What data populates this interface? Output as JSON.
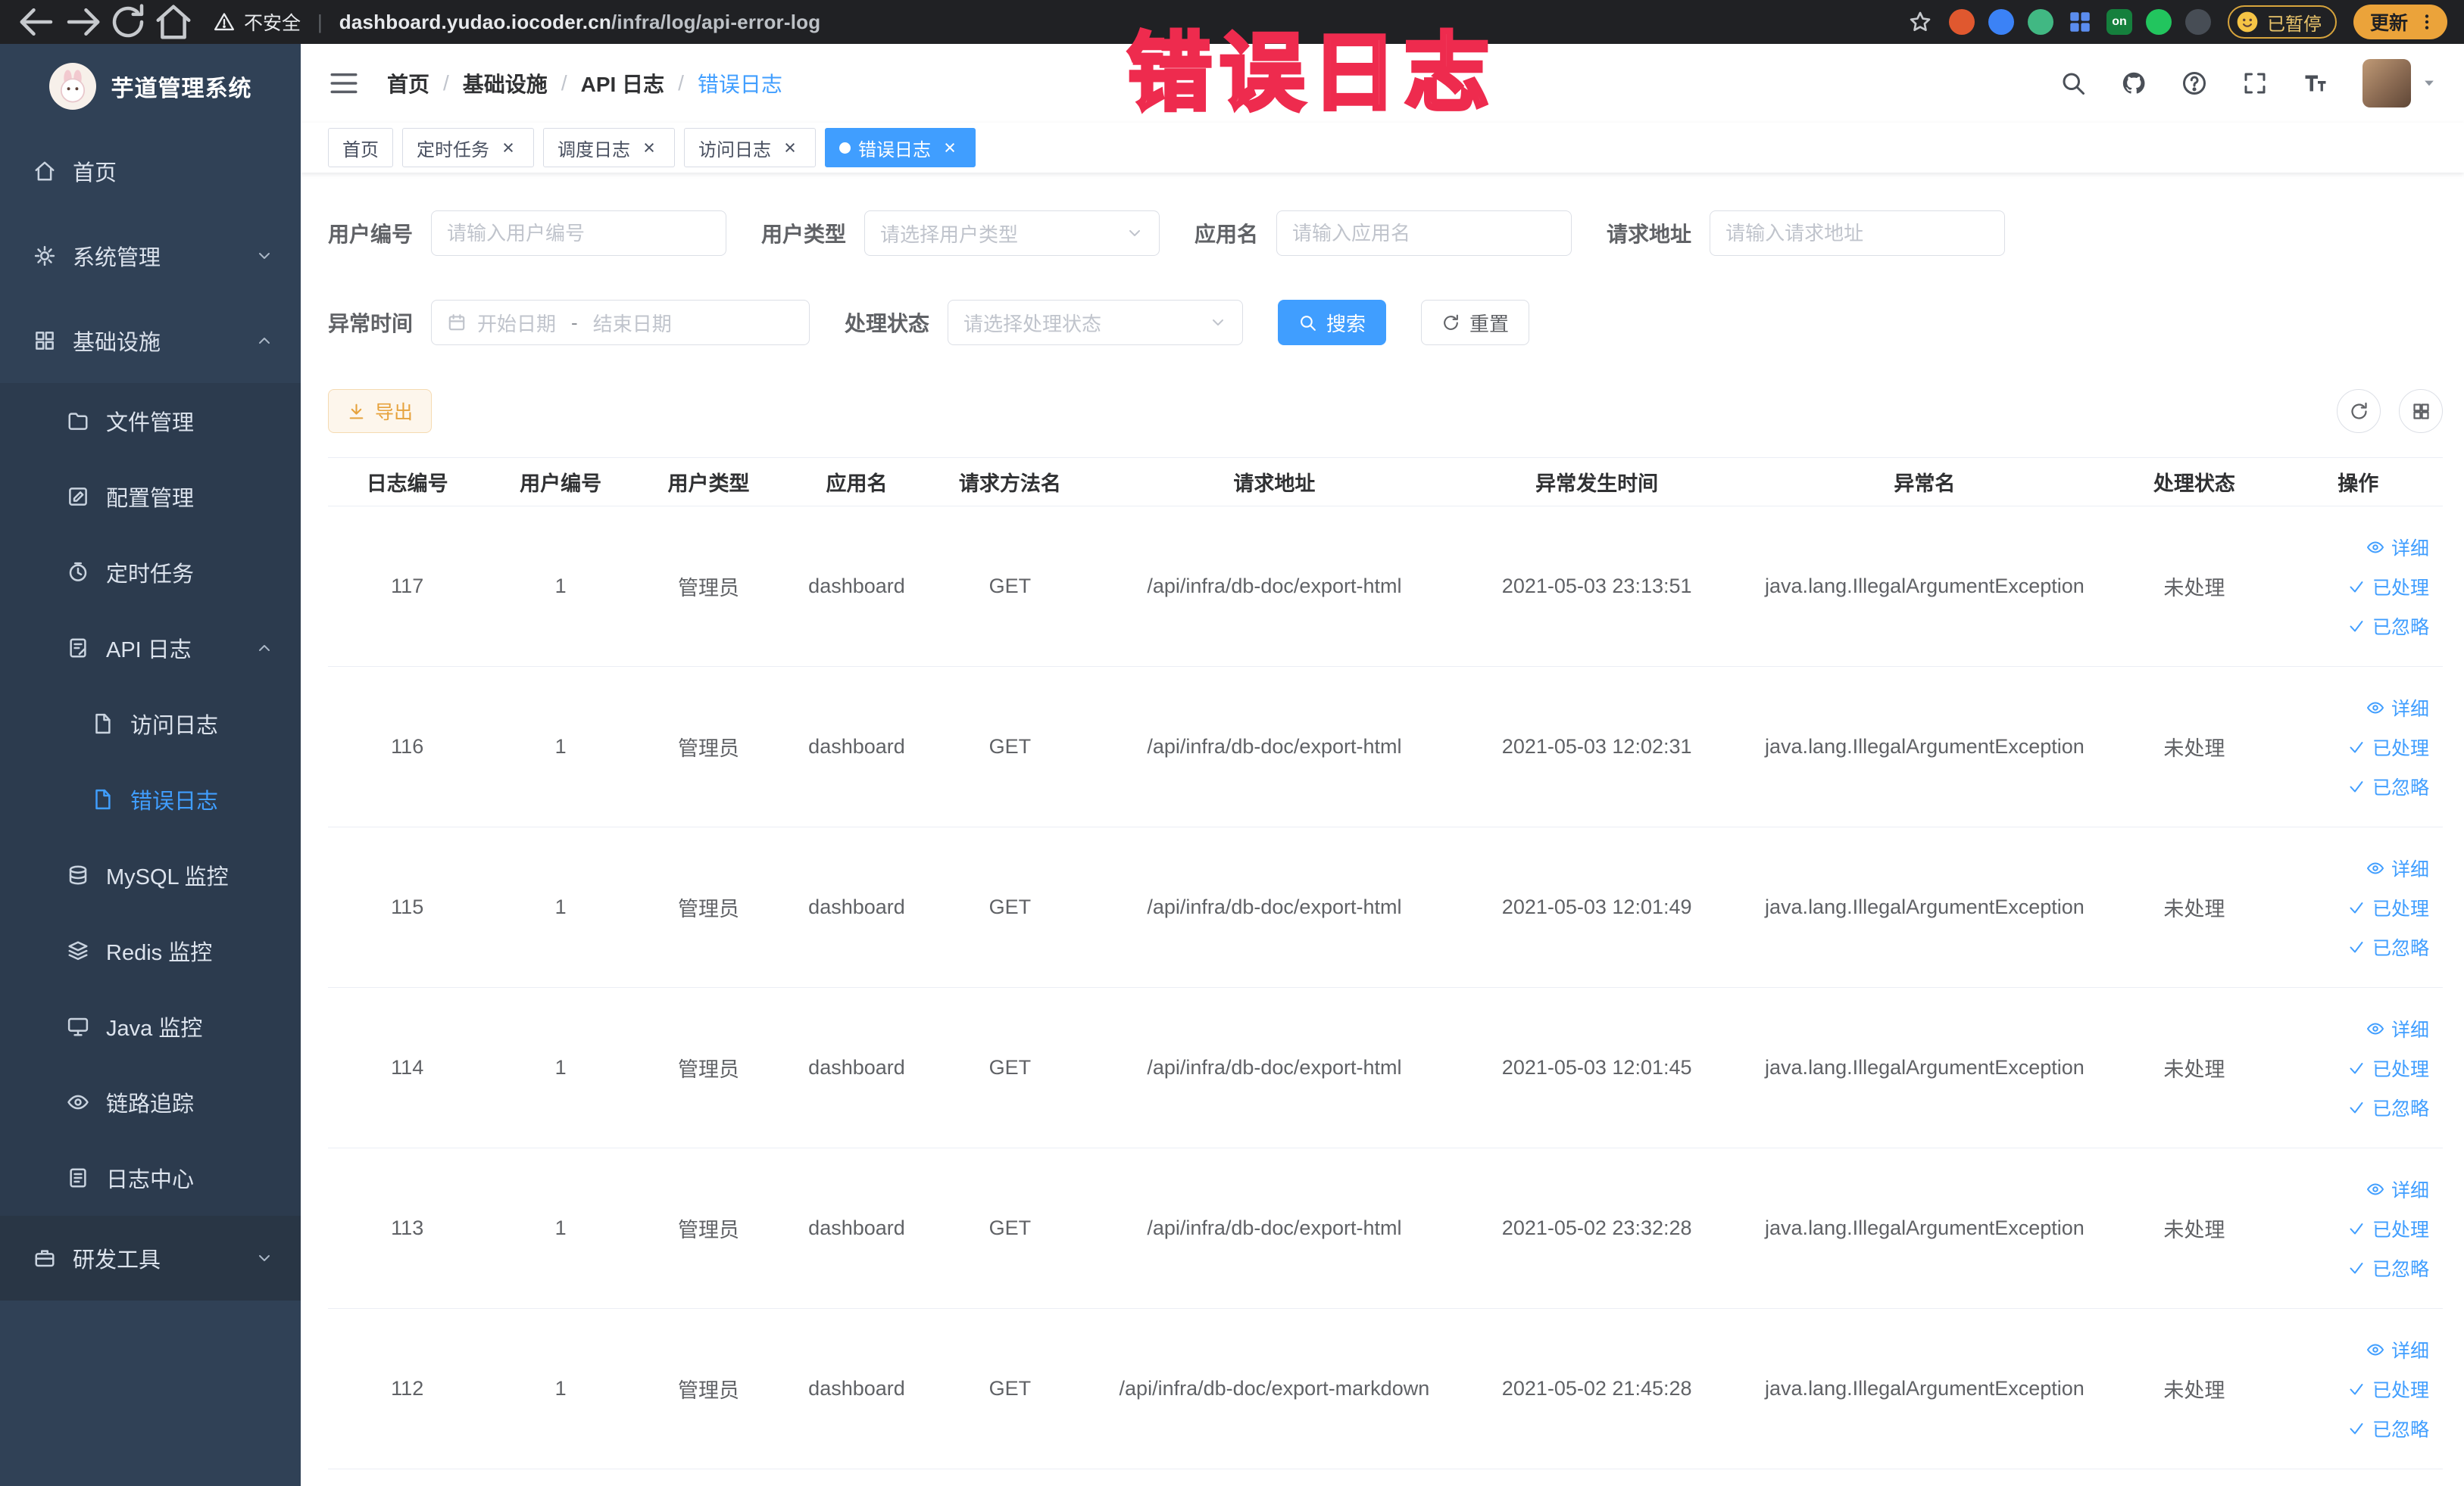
{
  "annotation": {
    "text": "错误日志"
  },
  "browser": {
    "security_label": "不安全",
    "url_divider": "|",
    "url_host": "dashboard.yudao.iocoder.cn",
    "url_path": "/infra/log/api-error-log",
    "paused_badge": "已暂停",
    "update_button": "更新",
    "extensions": [
      {
        "name": "shield-extension-icon",
        "color": "#e0582f",
        "shape": "circle"
      },
      {
        "name": "drop-extension-icon",
        "color": "#3b82f6",
        "shape": "circle"
      },
      {
        "name": "vue-extension-icon",
        "color": "#41b883",
        "shape": "circle"
      },
      {
        "name": "grid-extension-icon",
        "color": "#5b8def",
        "shape": "grid"
      },
      {
        "name": "on-extension-icon",
        "color": "#15803d",
        "shape": "square",
        "text": "on"
      },
      {
        "name": "leaf-extension-icon",
        "color": "#22c55e",
        "shape": "circle"
      },
      {
        "name": "paw-extension-icon",
        "color": "#474d55",
        "shape": "circle"
      }
    ]
  },
  "sidebar": {
    "app_title": "芋道管理系统",
    "menu": [
      {
        "label": "首页",
        "icon": "home-icon",
        "level": 1
      },
      {
        "label": "系统管理",
        "icon": "gear-icon",
        "level": 1,
        "arrow": "down"
      },
      {
        "label": "基础设施",
        "icon": "infrastructure-icon",
        "level": 1,
        "arrow": "up"
      },
      {
        "label": "文件管理",
        "icon": "folder-icon",
        "level": 2
      },
      {
        "label": "配置管理",
        "icon": "edit-icon",
        "level": 2
      },
      {
        "label": "定时任务",
        "icon": "timer-icon",
        "level": 2
      },
      {
        "label": "API 日志",
        "icon": "log-icon",
        "level": 2,
        "arrow": "up"
      },
      {
        "label": "访问日志",
        "icon": "document-icon",
        "level": 3
      },
      {
        "label": "错误日志",
        "icon": "document-icon",
        "level": 3,
        "active": true
      },
      {
        "label": "MySQL 监控",
        "icon": "database-icon",
        "level": 2
      },
      {
        "label": "Redis 监控",
        "icon": "layers-icon",
        "level": 2
      },
      {
        "label": "Java 监控",
        "icon": "monitor-icon",
        "level": 2
      },
      {
        "label": "链路追踪",
        "icon": "trace-eye-icon",
        "level": 2
      },
      {
        "label": "日志中心",
        "icon": "log-center-icon",
        "level": 2
      },
      {
        "label": "研发工具",
        "icon": "tools-icon",
        "level": 1,
        "arrow": "down",
        "dark": true
      }
    ]
  },
  "breadcrumb": [
    "首页",
    "基础设施",
    "API 日志",
    "错误日志"
  ],
  "breadcrumb_separator": "/",
  "navbar": {
    "icons": [
      "search-icon",
      "github-icon",
      "question-icon",
      "fullscreen-icon",
      "font-size-icon"
    ]
  },
  "tabs": [
    {
      "label": "首页",
      "closable": false,
      "active": false
    },
    {
      "label": "定时任务",
      "closable": true,
      "active": false
    },
    {
      "label": "调度日志",
      "closable": true,
      "active": false
    },
    {
      "label": "访问日志",
      "closable": true,
      "active": false
    },
    {
      "label": "错误日志",
      "closable": true,
      "active": true
    }
  ],
  "filters": {
    "user_id": {
      "label": "用户编号",
      "placeholder": "请输入用户编号"
    },
    "user_type": {
      "label": "用户类型",
      "placeholder": "请选择用户类型"
    },
    "app_name": {
      "label": "应用名",
      "placeholder": "请输入应用名"
    },
    "request_url": {
      "label": "请求地址",
      "placeholder": "请输入请求地址"
    },
    "exception_time": {
      "label": "异常时间",
      "start_placeholder": "开始日期",
      "end_placeholder": "结束日期",
      "range_separator": "-"
    },
    "process_status": {
      "label": "处理状态",
      "placeholder": "请选择处理状态"
    },
    "search_button": "搜索",
    "reset_button": "重置"
  },
  "toolbar": {
    "export_button": "导出"
  },
  "table": {
    "columns": [
      "日志编号",
      "用户编号",
      "用户类型",
      "应用名",
      "请求方法名",
      "请求地址",
      "异常发生时间",
      "异常名",
      "处理状态",
      "操作"
    ],
    "actions": [
      {
        "label": "详细",
        "icon": "eye-icon",
        "name": "detail-link"
      },
      {
        "label": "已处理",
        "icon": "check-icon",
        "name": "processed-link"
      },
      {
        "label": "已忽略",
        "icon": "check-icon",
        "name": "ignored-link"
      }
    ],
    "rows": [
      {
        "id": "117",
        "user_id": "1",
        "user_type": "管理员",
        "app": "dashboard",
        "method": "GET",
        "url": "/api/infra/db-doc/export-html",
        "time": "2021-05-03 23:13:51",
        "exception": "java.lang.IllegalArgumentException",
        "status": "未处理"
      },
      {
        "id": "116",
        "user_id": "1",
        "user_type": "管理员",
        "app": "dashboard",
        "method": "GET",
        "url": "/api/infra/db-doc/export-html",
        "time": "2021-05-03 12:02:31",
        "exception": "java.lang.IllegalArgumentException",
        "status": "未处理"
      },
      {
        "id": "115",
        "user_id": "1",
        "user_type": "管理员",
        "app": "dashboard",
        "method": "GET",
        "url": "/api/infra/db-doc/export-html",
        "time": "2021-05-03 12:01:49",
        "exception": "java.lang.IllegalArgumentException",
        "status": "未处理"
      },
      {
        "id": "114",
        "user_id": "1",
        "user_type": "管理员",
        "app": "dashboard",
        "method": "GET",
        "url": "/api/infra/db-doc/export-html",
        "time": "2021-05-03 12:01:45",
        "exception": "java.lang.IllegalArgumentException",
        "status": "未处理"
      },
      {
        "id": "113",
        "user_id": "1",
        "user_type": "管理员",
        "app": "dashboard",
        "method": "GET",
        "url": "/api/infra/db-doc/export-html",
        "time": "2021-05-02 23:32:28",
        "exception": "java.lang.IllegalArgumentException",
        "status": "未处理"
      },
      {
        "id": "112",
        "user_id": "1",
        "user_type": "管理员",
        "app": "dashboard",
        "method": "GET",
        "url": "/api/infra/db-doc/export-markdown",
        "time": "2021-05-02 21:45:28",
        "exception": "java.lang.IllegalArgumentException",
        "status": "未处理"
      }
    ]
  }
}
